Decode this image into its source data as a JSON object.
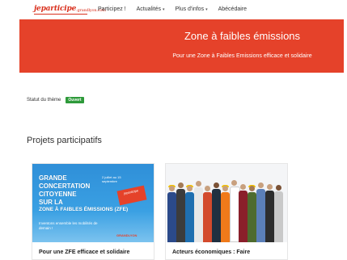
{
  "header": {
    "logo_text": "jeparticipe",
    "logo_suffix": ".grandlyon.com",
    "nav": [
      {
        "label": "Participez !",
        "has_caret": false
      },
      {
        "label": "Actualités",
        "has_caret": true
      },
      {
        "label": "Plus d'infos",
        "has_caret": true
      },
      {
        "label": "Abécédaire",
        "has_caret": false
      }
    ]
  },
  "hero": {
    "title": "Zone à faibles émissions",
    "subtitle": "Pour une Zone à Faibles Emissions efficace et solidaire",
    "color": "#e5422a"
  },
  "status": {
    "label": "Statut du thème",
    "badge": "Ouvert",
    "badge_color": "#2e9a3a"
  },
  "projects": {
    "section_title": "Projets participatifs",
    "cards": [
      {
        "title": "Pour une ZFE efficace et solidaire",
        "poster": {
          "lines": [
            "GRANDE",
            "CONCERTATION",
            "CITOYENNE",
            "SUR LA",
            "ZONE À FAIBLES ÉMISSIONS (ZFE)"
          ],
          "date": "2 juillet au 15 septembre",
          "tag": "jeparticipe",
          "subtext": "Inventons ensemble les mobilités de demain !",
          "city": "GRANDLYON"
        }
      },
      {
        "title": "Acteurs économiques : Faire",
        "image_icon": "workers-group-photo"
      }
    ]
  }
}
